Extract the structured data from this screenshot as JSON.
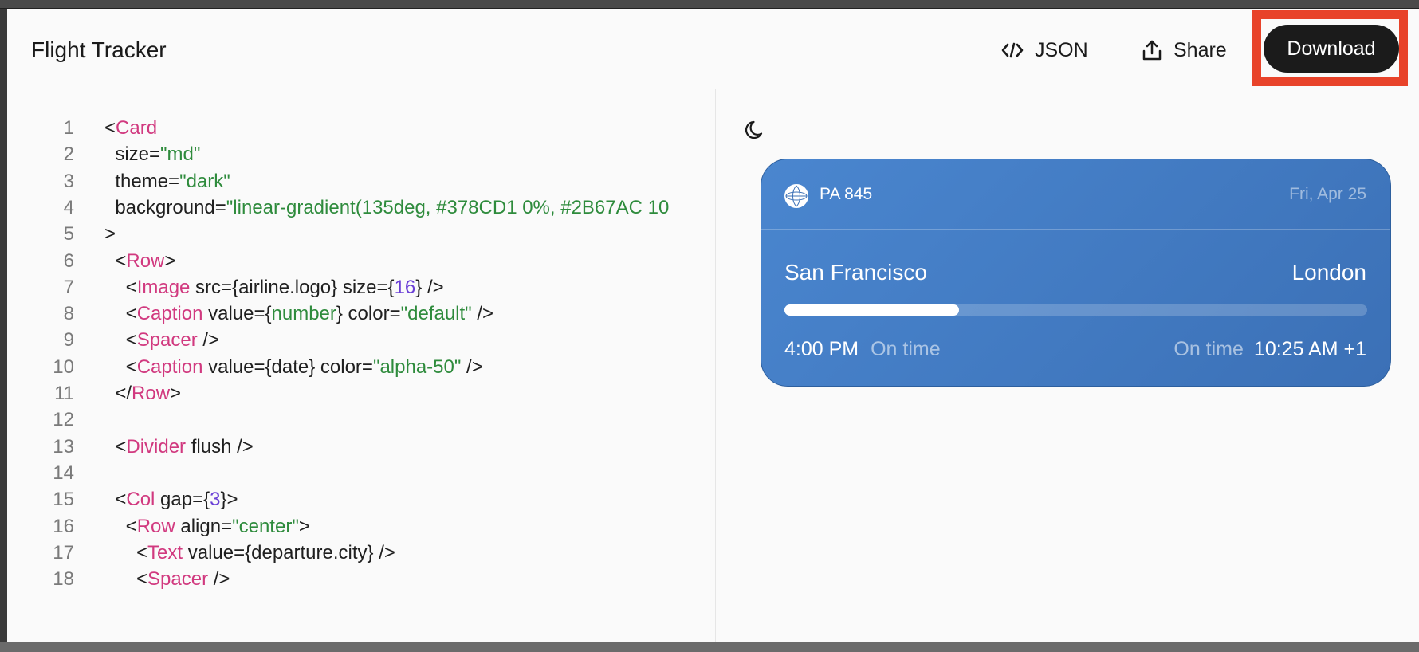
{
  "app": {
    "title": "Flight Tracker"
  },
  "toolbar": {
    "json_label": "JSON",
    "share_label": "Share",
    "download_label": "Download"
  },
  "editor": {
    "lines": [
      {
        "n": "1",
        "parts": [
          [
            "p",
            "<"
          ],
          [
            "t",
            "Card"
          ]
        ]
      },
      {
        "n": "2",
        "parts": [
          [
            "p",
            "  size="
          ],
          [
            "s",
            "\"md\""
          ]
        ]
      },
      {
        "n": "3",
        "parts": [
          [
            "p",
            "  theme="
          ],
          [
            "s",
            "\"dark\""
          ]
        ]
      },
      {
        "n": "4",
        "parts": [
          [
            "p",
            "  background="
          ],
          [
            "s",
            "\"linear-gradient(135deg, #378CD1 0%, #2B67AC 10"
          ]
        ]
      },
      {
        "n": "5",
        "parts": [
          [
            "p",
            ">"
          ]
        ]
      },
      {
        "n": "6",
        "parts": [
          [
            "p",
            "  <"
          ],
          [
            "t",
            "Row"
          ],
          [
            "p",
            ">"
          ]
        ]
      },
      {
        "n": "7",
        "parts": [
          [
            "p",
            "    <"
          ],
          [
            "t",
            "Image"
          ],
          [
            "p",
            " src={airline.logo} size={"
          ],
          [
            "n",
            "16"
          ],
          [
            "p",
            "} />"
          ]
        ]
      },
      {
        "n": "8",
        "parts": [
          [
            "p",
            "    <"
          ],
          [
            "t",
            "Caption"
          ],
          [
            "p",
            " value={"
          ],
          [
            "s",
            "number"
          ],
          [
            "p",
            "} color="
          ],
          [
            "s",
            "\"default\""
          ],
          [
            "p",
            " />"
          ]
        ]
      },
      {
        "n": "9",
        "parts": [
          [
            "p",
            "    <"
          ],
          [
            "t",
            "Spacer"
          ],
          [
            "p",
            " />"
          ]
        ]
      },
      {
        "n": "10",
        "parts": [
          [
            "p",
            "    <"
          ],
          [
            "t",
            "Caption"
          ],
          [
            "p",
            " value={date} color="
          ],
          [
            "s",
            "\"alpha-50\""
          ],
          [
            "p",
            " />"
          ]
        ]
      },
      {
        "n": "11",
        "parts": [
          [
            "p",
            "  </"
          ],
          [
            "t",
            "Row"
          ],
          [
            "p",
            ">"
          ]
        ]
      },
      {
        "n": "12",
        "parts": []
      },
      {
        "n": "13",
        "parts": [
          [
            "p",
            "  <"
          ],
          [
            "t",
            "Divider"
          ],
          [
            "p",
            " flush />"
          ]
        ]
      },
      {
        "n": "14",
        "parts": []
      },
      {
        "n": "15",
        "parts": [
          [
            "p",
            "  <"
          ],
          [
            "t",
            "Col"
          ],
          [
            "p",
            " gap={"
          ],
          [
            "n",
            "3"
          ],
          [
            "p",
            "}>"
          ]
        ]
      },
      {
        "n": "16",
        "parts": [
          [
            "p",
            "    <"
          ],
          [
            "t",
            "Row"
          ],
          [
            "p",
            " align="
          ],
          [
            "s",
            "\"center\""
          ],
          [
            "p",
            ">"
          ]
        ]
      },
      {
        "n": "17",
        "parts": [
          [
            "p",
            "      <"
          ],
          [
            "t",
            "Text"
          ],
          [
            "p",
            " value={departure.city} />"
          ]
        ]
      },
      {
        "n": "18",
        "parts": [
          [
            "p",
            "      <"
          ],
          [
            "t",
            "Spacer"
          ],
          [
            "p",
            " />"
          ]
        ]
      }
    ]
  },
  "preview": {
    "theme_icon": "moon-icon",
    "card": {
      "flight_number": "PA 845",
      "date": "Fri, Apr 25",
      "departure_city": "San Francisco",
      "arrival_city": "London",
      "progress": 0.3,
      "departure_time": "4:00 PM",
      "departure_status": "On time",
      "arrival_status": "On time",
      "arrival_time": "10:25 AM +1"
    }
  },
  "colors": {
    "accent_outline": "#e8432a",
    "download_bg": "#1b1b1b",
    "tag": "#d1397f",
    "string": "#2e8b3c",
    "number": "#6a3fd6",
    "card_start": "#4a86cf",
    "card_end": "#3b70b6"
  }
}
